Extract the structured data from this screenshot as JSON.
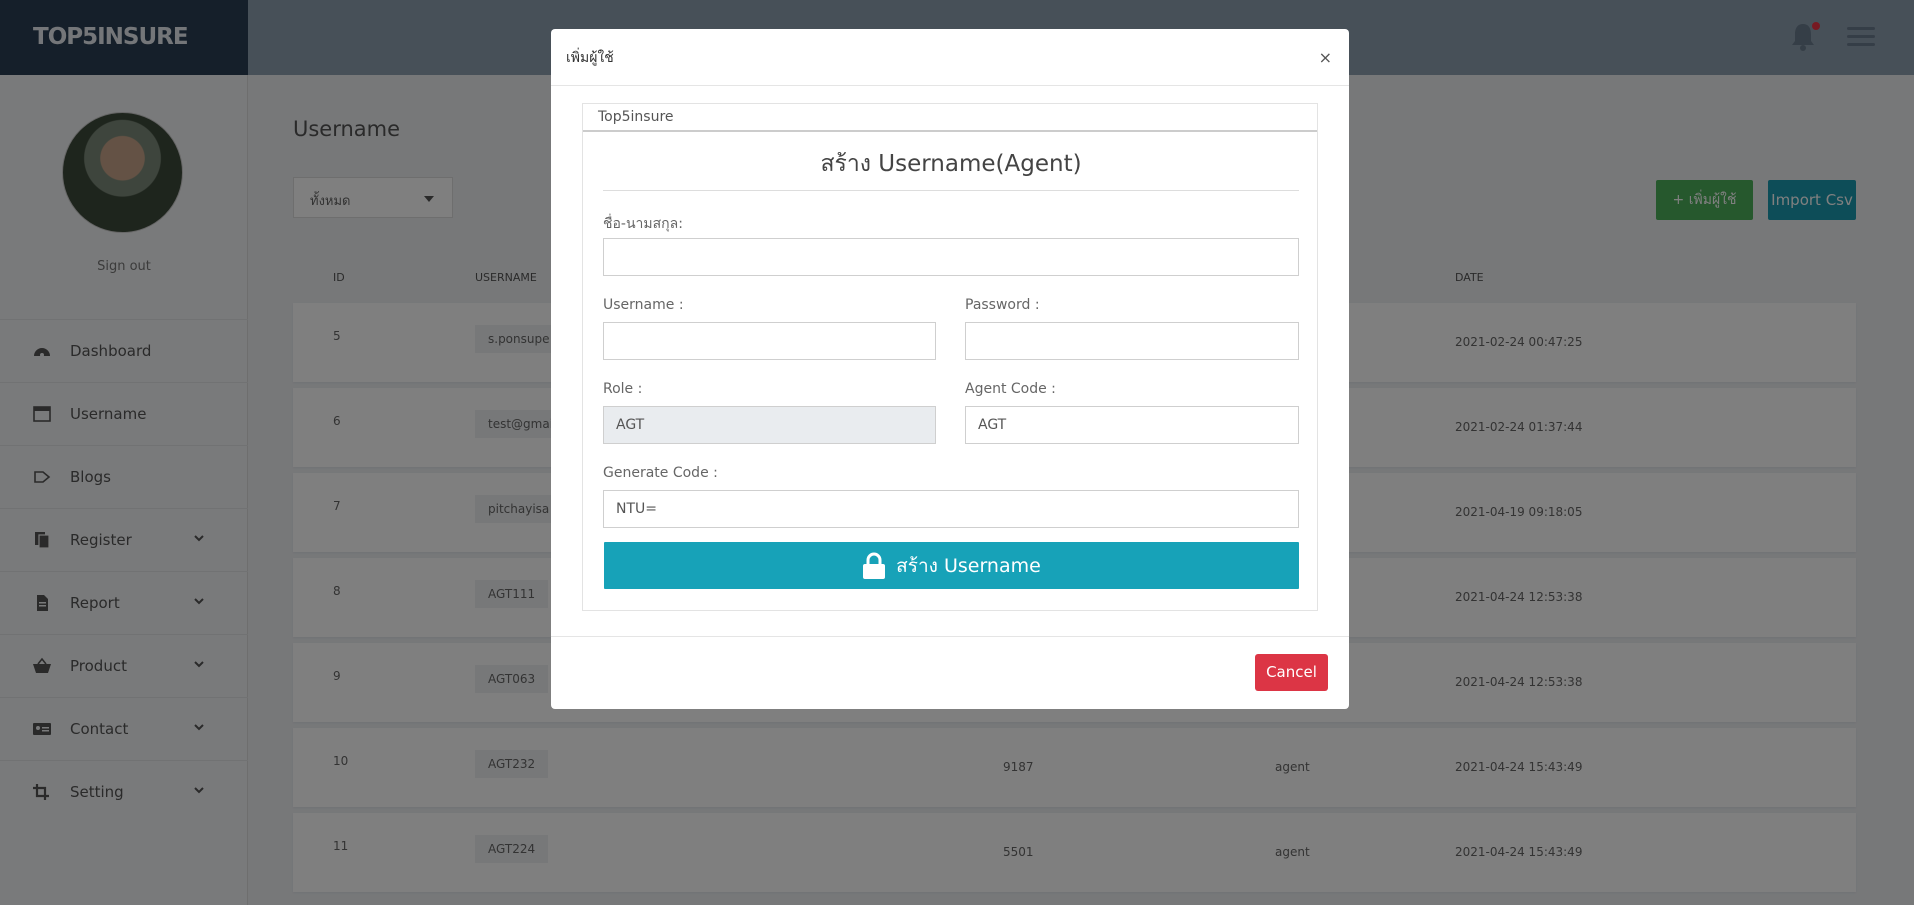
{
  "brand": "TOP5INSURE",
  "colors": {
    "brand_bg": "#2a3f54",
    "accent": "#17a2b8",
    "success": "#4cb05a",
    "danger": "#dc3545"
  },
  "header": {
    "icons": [
      "bell-icon",
      "hamburger-icon"
    ]
  },
  "sidebar": {
    "signout": "Sign out",
    "items": [
      {
        "label": "Dashboard",
        "icon": "dashboard-icon",
        "expandable": false
      },
      {
        "label": "Username",
        "icon": "window-icon",
        "expandable": false
      },
      {
        "label": "Blogs",
        "icon": "blog-icon",
        "expandable": false
      },
      {
        "label": "Register",
        "icon": "copy-icon",
        "expandable": true
      },
      {
        "label": "Report",
        "icon": "file-icon",
        "expandable": true
      },
      {
        "label": "Product",
        "icon": "basket-icon",
        "expandable": true
      },
      {
        "label": "Contact",
        "icon": "id-card-icon",
        "expandable": true
      },
      {
        "label": "Setting",
        "icon": "crop-icon",
        "expandable": true
      }
    ]
  },
  "main": {
    "title": "Username",
    "filter_value": "ทั้งหมด",
    "add_button": "+ เพิ่มผู้ใช้",
    "import_button": "Import Csv",
    "columns": {
      "id": "ID",
      "username": "USERNAME",
      "date": "DATE"
    },
    "rows": [
      {
        "id": "5",
        "username": "s.ponsupe",
        "code": "",
        "role": "",
        "date": "2021-02-24 00:47:25"
      },
      {
        "id": "6",
        "username": "test@gmai",
        "code": "",
        "role": "",
        "date": "2021-02-24 01:37:44"
      },
      {
        "id": "7",
        "username": "pitchayisa",
        "code": "",
        "role": "",
        "date": "2021-04-19 09:18:05"
      },
      {
        "id": "8",
        "username": "AGT111",
        "code": "",
        "role": "",
        "date": "2021-04-24 12:53:38"
      },
      {
        "id": "9",
        "username": "AGT063",
        "code": "",
        "role": "",
        "date": "2021-04-24 12:53:38"
      },
      {
        "id": "10",
        "username": "AGT232",
        "code": "9187",
        "role": "agent",
        "date": "2021-04-24 15:43:49"
      },
      {
        "id": "11",
        "username": "AGT224",
        "code": "5501",
        "role": "agent",
        "date": "2021-04-24 15:43:49"
      }
    ]
  },
  "modal": {
    "title": "เพิ่มผู้ใช้",
    "close": "×",
    "card_header": "Top5insure",
    "card_title": "สร้าง Username(Agent)",
    "fullname_label": "ชื่อ-นามสกุล:",
    "fullname_value": "",
    "username_label": "Username :",
    "username_value": "",
    "password_label": "Password :",
    "password_value": "",
    "role_label": "Role :",
    "role_value": "AGT",
    "agent_code_label": "Agent Code :",
    "agent_code_value": "AGT",
    "generate_code_label": "Generate Code :",
    "generate_code_value": "NTU=",
    "create_button": "สร้าง Username",
    "cancel_button": "Cancel"
  }
}
